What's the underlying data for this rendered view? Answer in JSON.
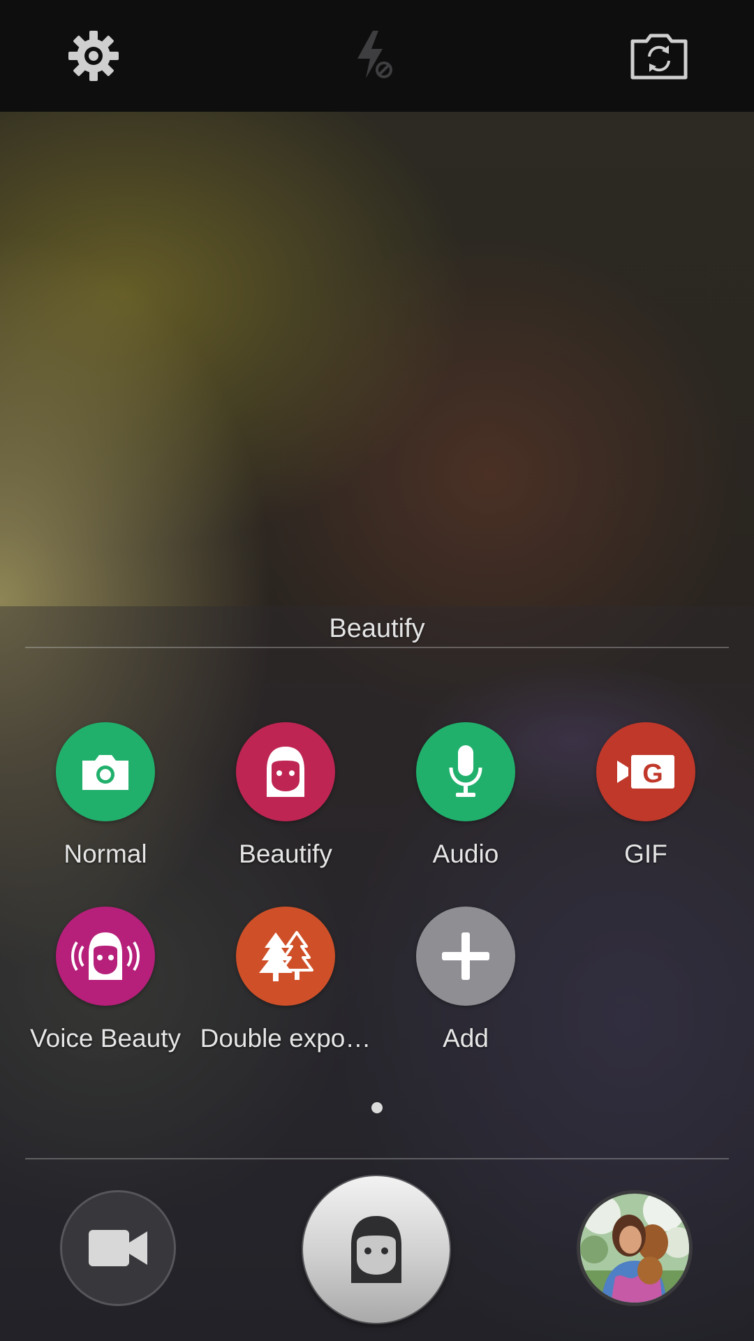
{
  "top_bar": {
    "settings_icon": "gear-icon",
    "flash_icon": "flash-off-icon",
    "switch_camera_icon": "switch-camera-icon"
  },
  "mode_panel": {
    "title": "Beautify",
    "modes": [
      {
        "label": "Normal",
        "icon": "camera-icon",
        "color": "#21b06c"
      },
      {
        "label": "Beautify",
        "icon": "beautify-face-icon",
        "color": "#bf2553"
      },
      {
        "label": "Audio",
        "icon": "microphone-icon",
        "color": "#21b06c"
      },
      {
        "label": "GIF",
        "icon": "gif-icon",
        "color": "#c0382a"
      },
      {
        "label": "Voice Beauty",
        "icon": "voice-beauty-icon",
        "color": "#b61f7a"
      },
      {
        "label": "Double expo…",
        "icon": "trees-icon",
        "color": "#cf5028"
      },
      {
        "label": "Add",
        "icon": "plus-icon",
        "color": "#8e8e93"
      }
    ],
    "page_count": 1
  },
  "bottom_bar": {
    "video_icon": "video-camera-icon",
    "shutter_icon": "beautify-face-icon",
    "gallery_icon": "gallery-thumbnail"
  }
}
